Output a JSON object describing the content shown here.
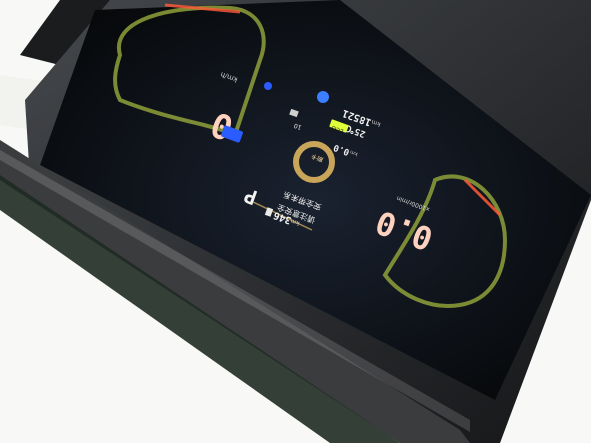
{
  "cluster": {
    "speed_value": "0",
    "speed_unit": "km/h",
    "rpm_value": "0.0",
    "rpm_unit": "x1000r/min",
    "gear": "P",
    "odometer": "18521",
    "odometer_unit": "km",
    "trip": "0.0",
    "trip_unit": "km",
    "temperature": "25℃",
    "eco_badge": "ECO",
    "range_value": "346",
    "range_unit": "km",
    "battery_value": "10",
    "status_text_1": "安全带未系",
    "status_text_2": "请注意安全",
    "center_label": "刷卡"
  },
  "colors": {
    "accent_orange": "#ff8c3a",
    "gauge_ring": "#c9a55a",
    "glow_green": "#8fa03a",
    "indicator_blue": "#2a5cff",
    "indicator_green": "#3ec03a",
    "screen_dark": "#0b0d10"
  },
  "icons": [
    "seatbelt-icon",
    "fuel-icon",
    "battery-icon",
    "headlight-icon",
    "parking-lamp-icon",
    "green-led-icon"
  ]
}
